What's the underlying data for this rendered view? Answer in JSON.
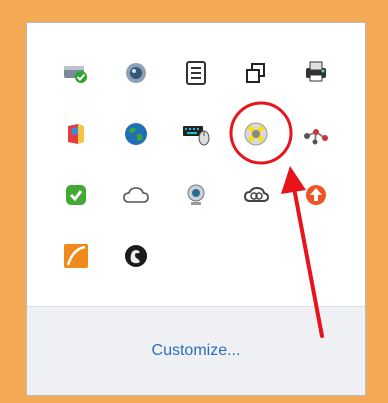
{
  "flyout": {
    "customize_label": "Customize...",
    "accent": "#2a6ebb",
    "annotation_color": "#e8141c",
    "icons": [
      {
        "name": "checkmark-drive-icon"
      },
      {
        "name": "webcam-sphere-icon"
      },
      {
        "name": "document-list-icon"
      },
      {
        "name": "window-copy-icon"
      },
      {
        "name": "printer-icon"
      },
      {
        "name": "colorful-book-icon"
      },
      {
        "name": "globe-icon"
      },
      {
        "name": "keyboard-mouse-icon"
      },
      {
        "name": "yellow-x-network-icon"
      },
      {
        "name": "network-nodes-icon"
      },
      {
        "name": "green-app-icon"
      },
      {
        "name": "cloud-outline-icon"
      },
      {
        "name": "webcam-icon"
      },
      {
        "name": "creative-cloud-icon"
      },
      {
        "name": "update-arrow-icon"
      },
      {
        "name": "orange-app-icon"
      },
      {
        "name": "black-app-icon"
      }
    ]
  }
}
